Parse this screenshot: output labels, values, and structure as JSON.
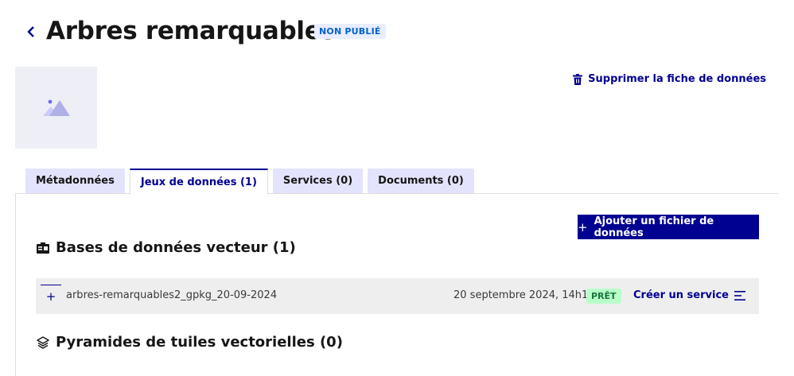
{
  "header": {
    "title": "Arbres remarquables",
    "status_badge": "NON PUBLIÉ"
  },
  "actions": {
    "delete_label": "Supprimer la fiche de données",
    "add_file_label": "Ajouter un fichier de données"
  },
  "tabs": [
    {
      "label": "Métadonnées",
      "active": false
    },
    {
      "label": "Jeux de données (1)",
      "active": true
    },
    {
      "label": "Services (0)",
      "active": false
    },
    {
      "label": "Documents (0)",
      "active": false
    }
  ],
  "sections": {
    "vector_db": {
      "title": "Bases de données vecteur (1)",
      "items": [
        {
          "name": "arbres-remarquables2_gpkg_20-09-2024",
          "date": "20 septembre 2024, 14h12",
          "status": "PRÊT",
          "action": "Créer un service"
        }
      ]
    },
    "vector_tiles": {
      "title": "Pyramides de tuiles vectorielles (0)"
    }
  },
  "colors": {
    "primary": "#000091",
    "badge_info_bg": "#e8edff",
    "badge_info_text": "#0063cb",
    "badge_success_bg": "#b8fec9",
    "badge_success_text": "#18753c"
  }
}
